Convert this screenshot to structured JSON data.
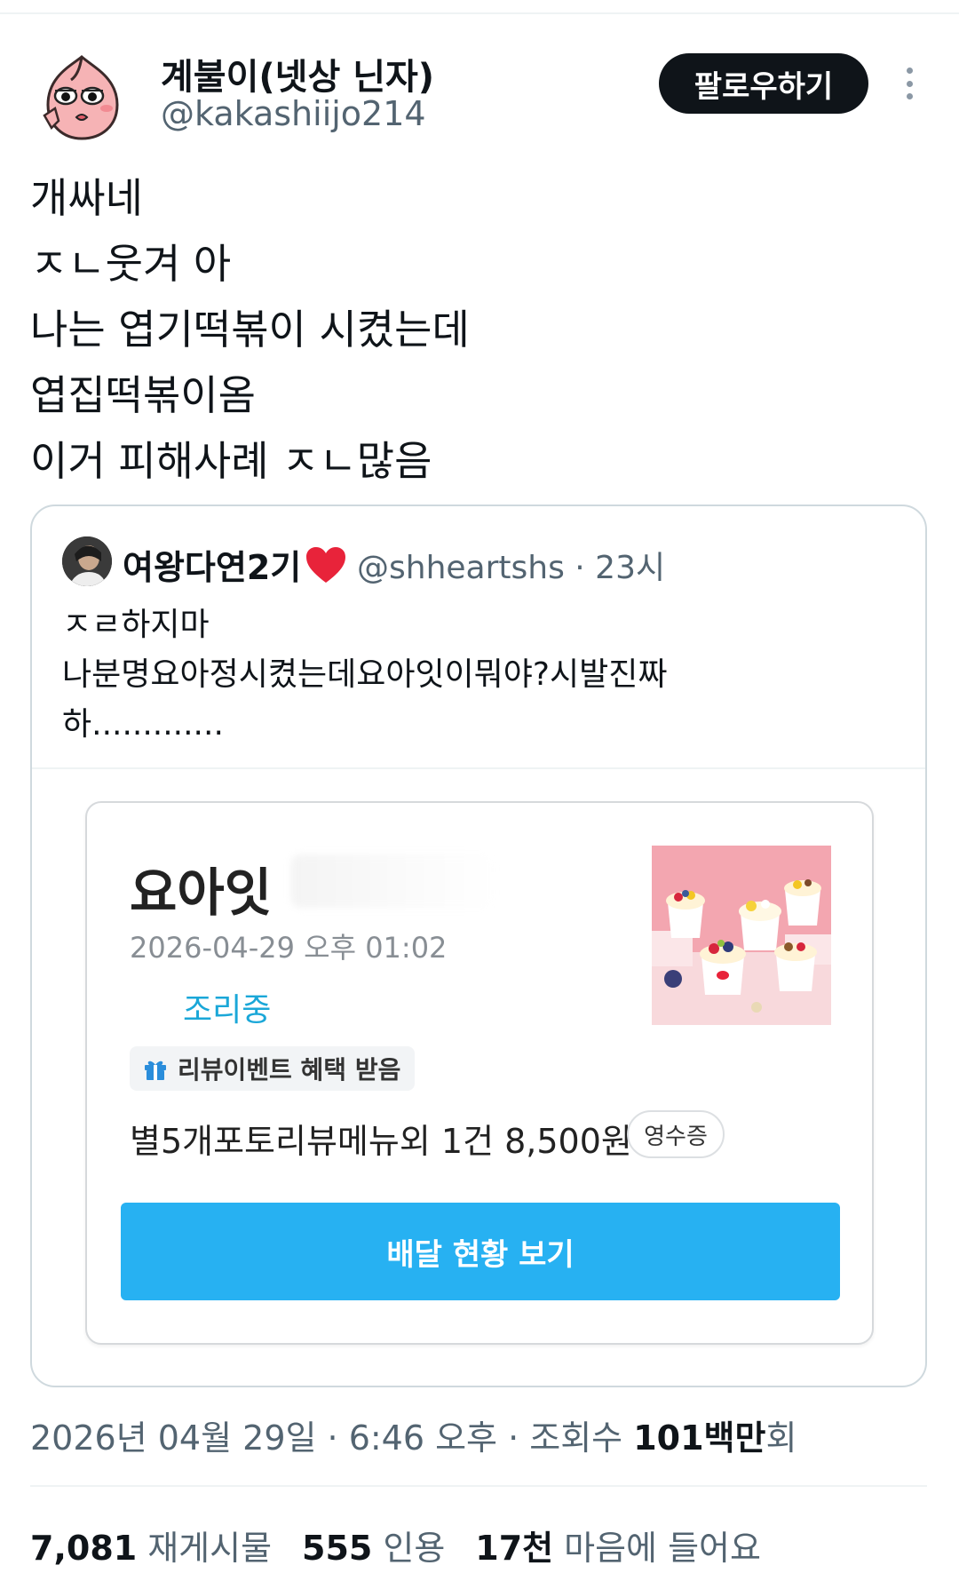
{
  "author": {
    "display_name": "계불이(넷상 닌자)",
    "handle": "@kakashiijo214",
    "follow_label": "팔로우하기"
  },
  "tweet": {
    "lines": [
      "개싸네",
      "ㅈㄴ웃겨 아",
      "나는 엽기떡볶이 시켰는데",
      "엽집떡볶이옴",
      "이거 피해사례 ㅈㄴ많음"
    ]
  },
  "quoted": {
    "name": "여왕다연2기",
    "handle_time": "@shheartshs · 23시",
    "lines": [
      "ㅈㄹ하지마",
      "나분명요아정시켰는데요아잇이뭐야?시발진짜",
      "하............."
    ],
    "order": {
      "store_name": "요아잇",
      "date": "2026-04-29 오후 01:02",
      "status": "조리중",
      "review_tag": "리뷰이벤트 혜택 받음",
      "summary": "별5개포토리뷰메뉴외 1건 8,500원",
      "receipt_label": "영수증",
      "delivery_button": "배달 현황 보기"
    }
  },
  "meta": {
    "timestamp": "2026년 04월 29일 · 6:46 오후 · 조회수 ",
    "views_value": "101백만",
    "views_suffix": "회"
  },
  "stats": {
    "reposts_value": "7,081",
    "reposts_label": "재게시물",
    "quotes_value": "555",
    "quotes_label": "인용",
    "likes_value": "17천",
    "likes_label": "마음에 들어요"
  },
  "colors": {
    "accent_blue": "#27b1f2",
    "status_blue": "#1aa7d8",
    "heart_red": "#e8233a",
    "text_secondary": "#536471"
  }
}
